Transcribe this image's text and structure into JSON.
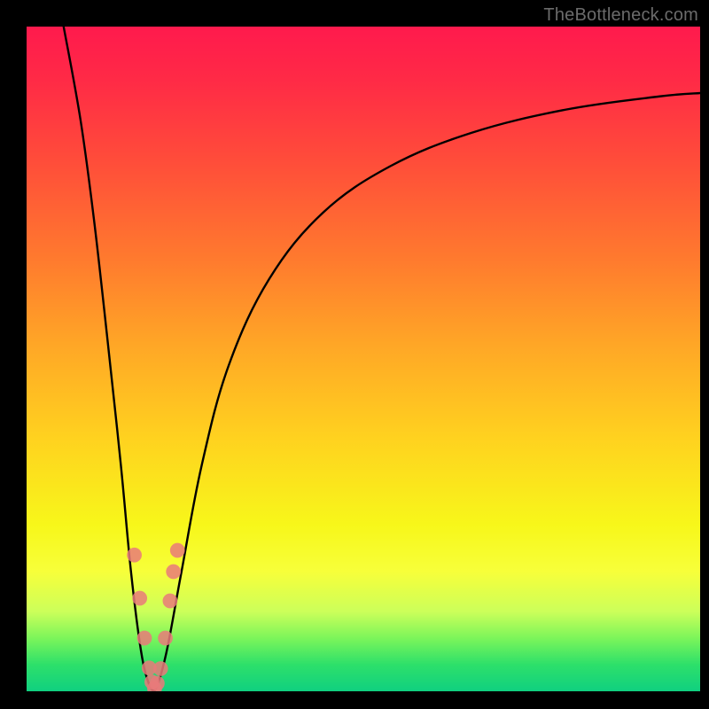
{
  "watermark": "TheBottleneck.com",
  "chart_data": {
    "type": "line",
    "title": "",
    "xlabel": "",
    "ylabel": "",
    "xlim": [
      0,
      100
    ],
    "ylim": [
      0,
      100
    ],
    "background_gradient": {
      "top": "#ff1a4d",
      "mid_upper": "#ff7a2e",
      "mid": "#ffd21f",
      "mid_lower": "#f7f71a",
      "bottom": "#10d080"
    },
    "series": [
      {
        "name": "curve-left",
        "stroke": "#000000",
        "x": [
          5.5,
          8,
          10,
          12,
          14,
          15.5,
          17,
          18.2,
          19
        ],
        "y": [
          100,
          86,
          71,
          53,
          34,
          18,
          6,
          1,
          0
        ]
      },
      {
        "name": "curve-right",
        "stroke": "#000000",
        "x": [
          19,
          19.8,
          21,
          23,
          26,
          30,
          36,
          44,
          54,
          66,
          80,
          94,
          100
        ],
        "y": [
          0,
          2,
          7,
          18,
          34,
          49,
          62,
          72,
          79,
          84,
          87.5,
          89.5,
          90
        ]
      }
    ],
    "points": {
      "name": "markers",
      "fill": "#e97a7a",
      "radius": 1.1,
      "x": [
        16.0,
        16.8,
        17.5,
        18.2,
        18.6,
        19.0,
        19.4,
        19.9,
        20.6,
        21.3,
        21.8,
        22.4
      ],
      "y": [
        20.5,
        14.0,
        8.0,
        3.5,
        1.4,
        0.4,
        1.2,
        3.4,
        8.0,
        13.6,
        18.0,
        21.2
      ]
    }
  }
}
